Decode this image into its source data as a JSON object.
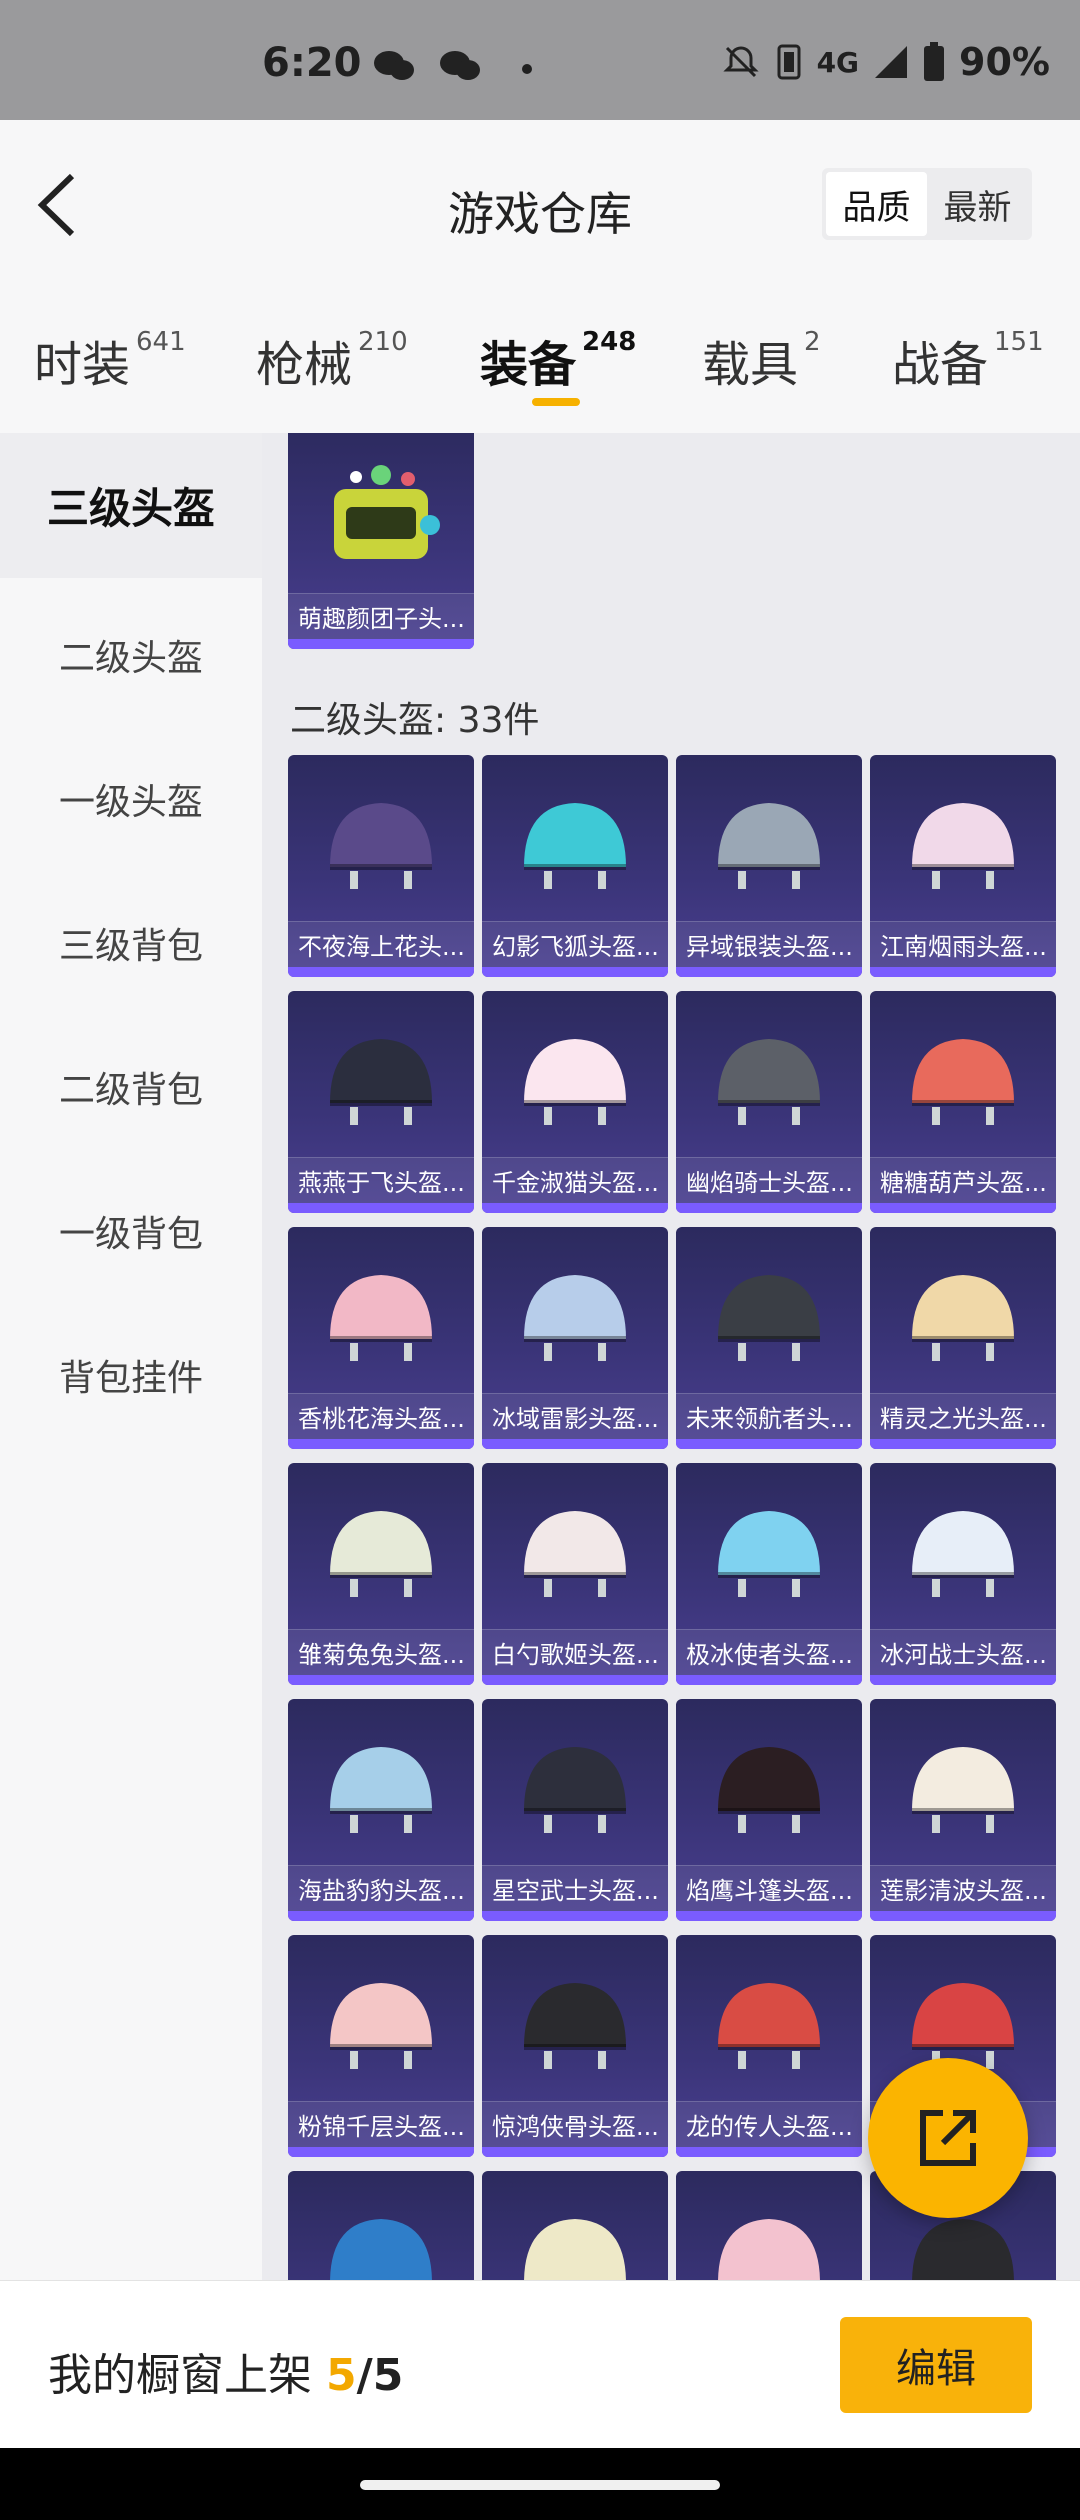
{
  "status_bar": {
    "time": "6:20",
    "network": "4G",
    "battery": "90%"
  },
  "header": {
    "title": "游戏仓库",
    "sort_options": [
      "品质",
      "最新"
    ],
    "sort_active": "品质"
  },
  "tabs": [
    {
      "label": "时装",
      "count": "641"
    },
    {
      "label": "枪械",
      "count": "210"
    },
    {
      "label": "装备",
      "count": "248",
      "active": true
    },
    {
      "label": "载具",
      "count": "2"
    },
    {
      "label": "战备",
      "count": "151"
    }
  ],
  "sidebar": {
    "active": "三级头盔",
    "items": [
      "二级头盔",
      "一级头盔",
      "三级背包",
      "二级背包",
      "一级背包",
      "背包挂件"
    ]
  },
  "top_item": {
    "name": "萌趣颜团子头..."
  },
  "section": {
    "title": "二级头盔: 33件"
  },
  "items": [
    "不夜海上花头...",
    "幻影飞狐头盔...",
    "异域银装头盔...",
    "江南烟雨头盔...",
    "燕燕于飞头盔...",
    "千金淑猫头盔...",
    "幽焰骑士头盔...",
    "糖糖葫芦头盔...",
    "香桃花海头盔...",
    "冰域雷影头盔...",
    "未来领航者头...",
    "精灵之光头盔...",
    "雏菊兔兔头盔...",
    "白勺歌姬头盔...",
    "极冰使者头盔...",
    "冰河战士头盔...",
    "海盐豹豹头盔...",
    "星空武士头盔...",
    "焰鹰斗篷头盔...",
    "莲影清波头盔...",
    "粉锦千层头盔...",
    "惊鸿侠骨头盔...",
    "龙的传人头盔...",
    ""
  ],
  "item_colors": [
    "#5a4a8a",
    "#3ec9d6",
    "#9aa7b5",
    "#f1d9e9",
    "#2b2e3e",
    "#fbe6ef",
    "#5c6068",
    "#e86a5c",
    "#f2b8c6",
    "#b7cdea",
    "#3a3e45",
    "#f0d8a8",
    "#e6ead8",
    "#f2e8e8",
    "#7fd2f0",
    "#e7eef8",
    "#a6cfe9",
    "#2d2f3c",
    "#2b1e22",
    "#f3ece0",
    "#f4c6c6",
    "#2a2a2e",
    "#d94c44",
    "#d94444",
    "#2f7ec9",
    "#eee9c8",
    "#f3c2cf",
    "#2a2a2e"
  ],
  "bottom_bar": {
    "label": "我的橱窗上架",
    "used": "5",
    "separator": "/",
    "total": "5",
    "edit_label": "编辑"
  }
}
